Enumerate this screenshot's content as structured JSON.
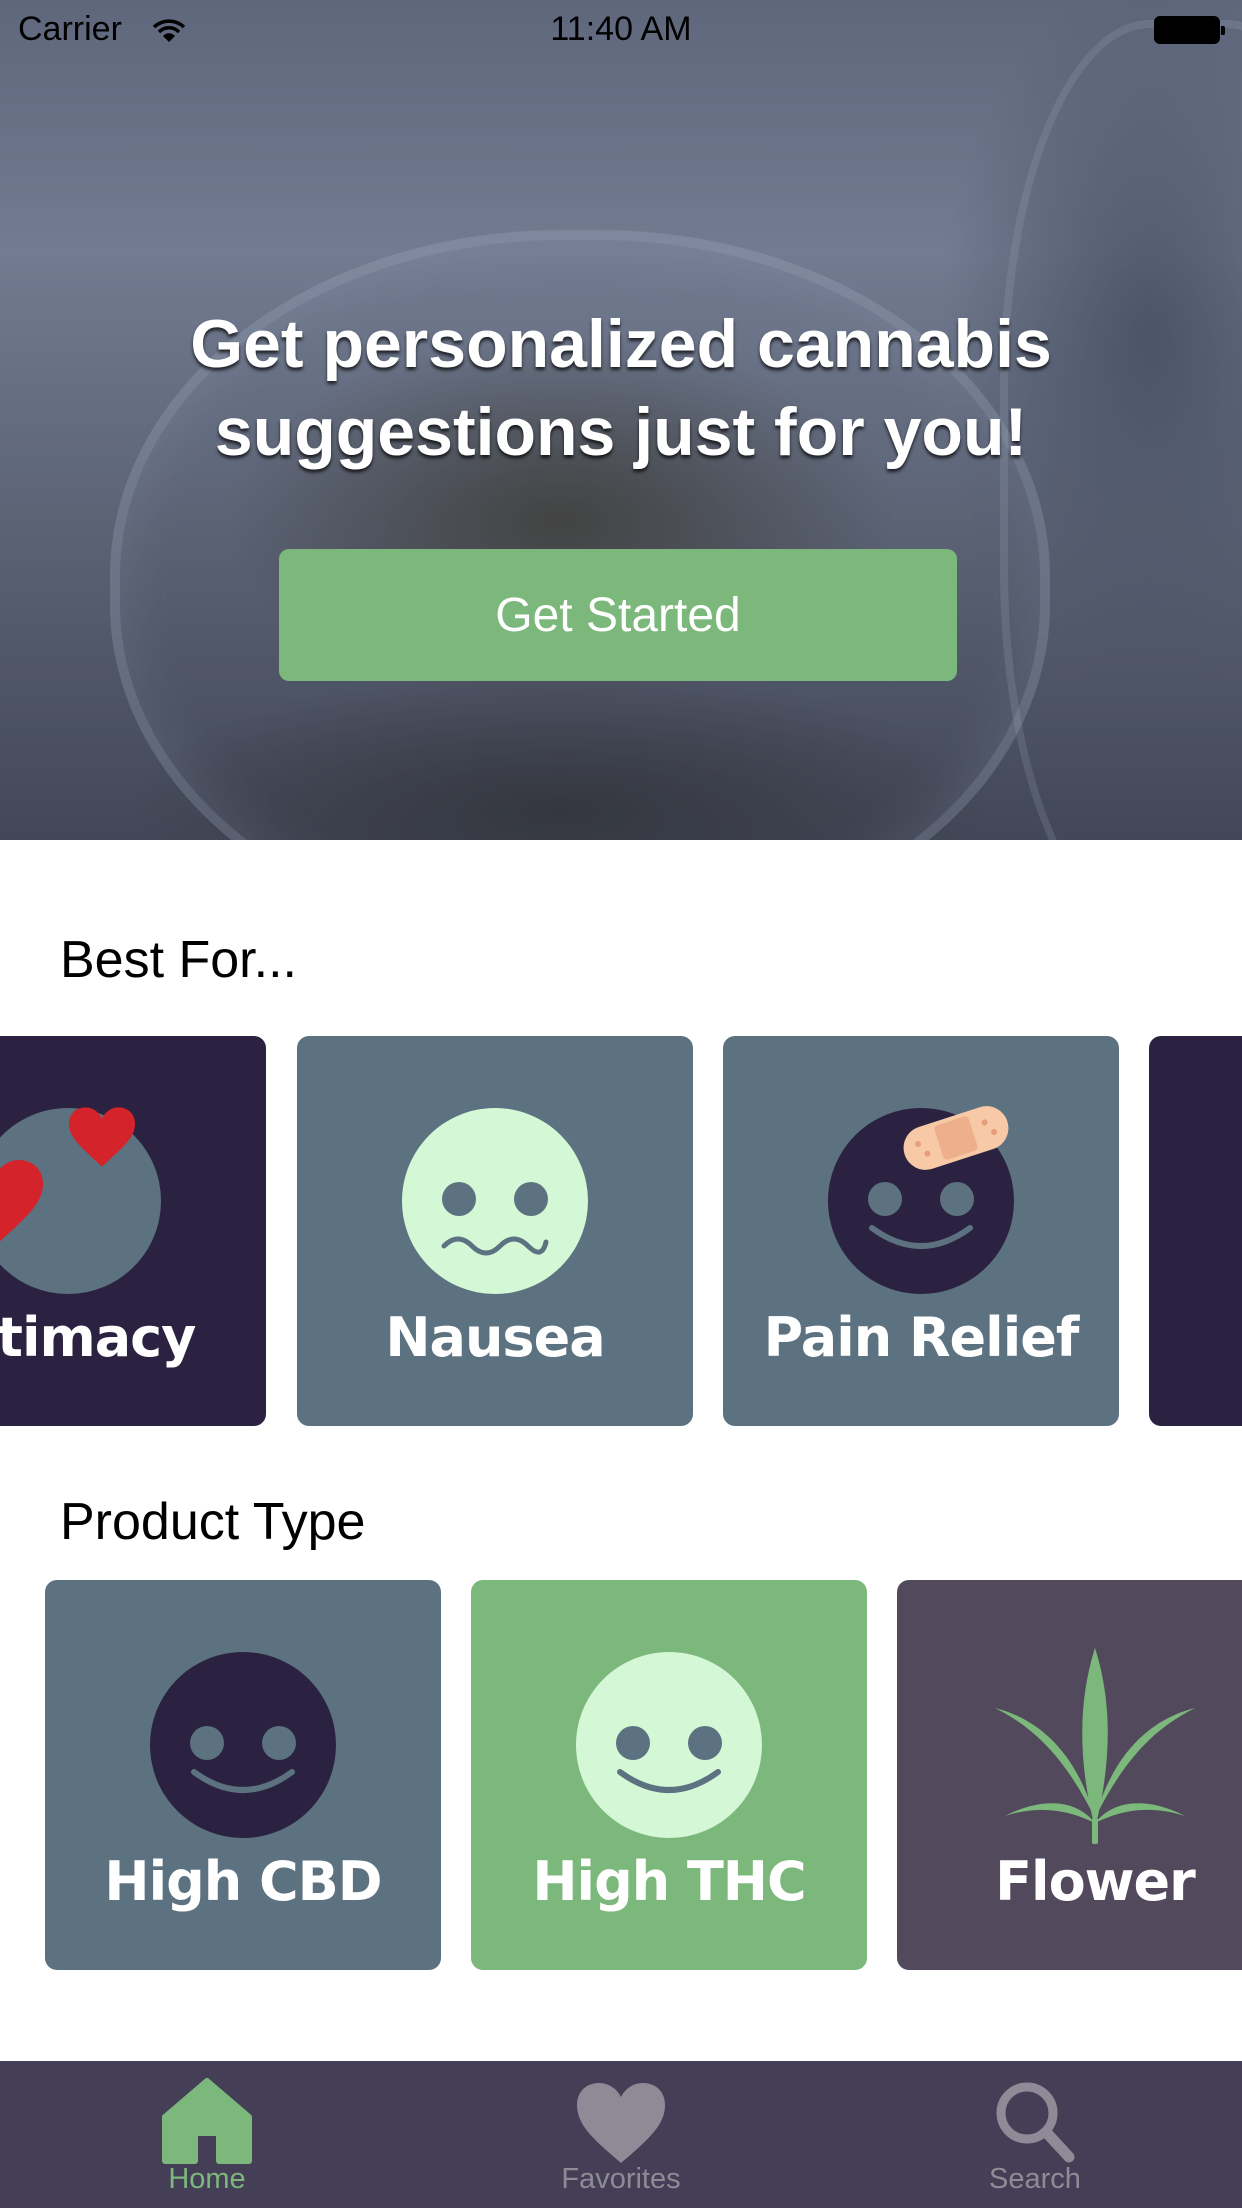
{
  "status_bar": {
    "carrier": "Carrier",
    "time": "11:40 AM",
    "wifi_icon": "wifi-icon",
    "battery_icon": "battery-icon"
  },
  "hero": {
    "title": "Get personalized cannabis suggestions just for you!",
    "button_label": "Get Started",
    "button_color": "#7cb77b"
  },
  "best_for": {
    "title": "Best For...",
    "items": [
      {
        "label": "Intimacy",
        "icon": "hearts-icon",
        "bg": "#2a2240"
      },
      {
        "label": "Nausea",
        "icon": "nauseous-face-icon",
        "bg": "#5c7280"
      },
      {
        "label": "Pain Relief",
        "icon": "bandaged-face-icon",
        "bg": "#5c7280"
      },
      {
        "label": "",
        "icon": "",
        "bg": "#2a2240"
      }
    ]
  },
  "product_type": {
    "title": "Product Type",
    "items": [
      {
        "label": "High CBD",
        "icon": "smiley-dark-icon",
        "bg": "#5c7280"
      },
      {
        "label": "High THC",
        "icon": "smiley-light-icon",
        "bg": "#7cb77b"
      },
      {
        "label": "Flower",
        "icon": "cannabis-leaf-icon",
        "bg": "#524a5c"
      }
    ]
  },
  "tab_bar": {
    "items": [
      {
        "label": "Home",
        "icon": "home-icon",
        "active": true,
        "color": "#7cb77b"
      },
      {
        "label": "Favorites",
        "icon": "heart-icon",
        "active": false,
        "color": "#8e8b96"
      },
      {
        "label": "Search",
        "icon": "search-icon",
        "active": false,
        "color": "#8e8b96"
      }
    ]
  }
}
